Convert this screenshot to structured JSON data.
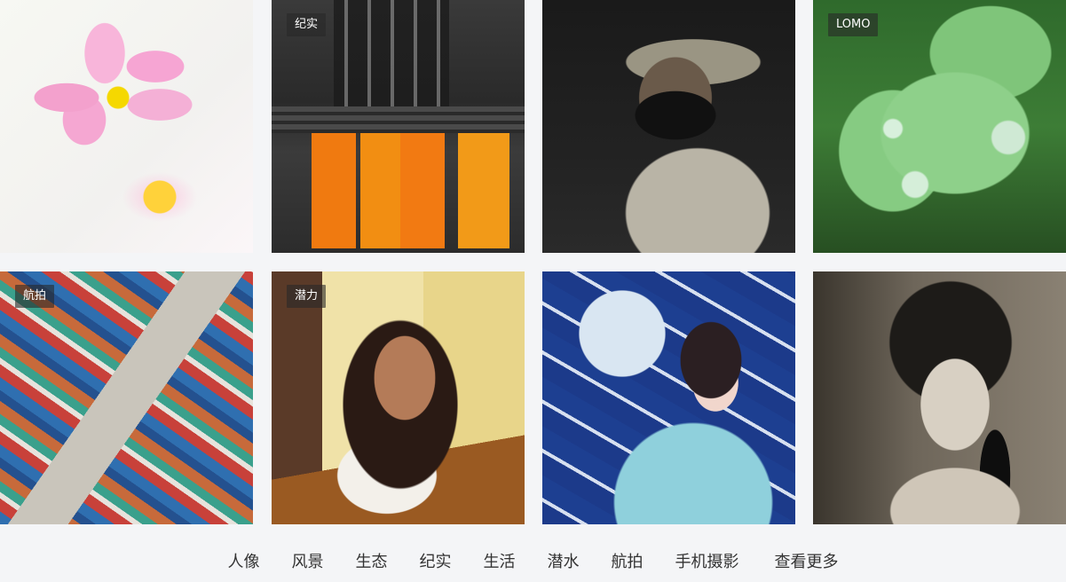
{
  "gallery": {
    "tiles": [
      {
        "alt": "pink cosmos flower",
        "tag": ""
      },
      {
        "alt": "monks in orange robes",
        "tag": "纪实"
      },
      {
        "alt": "masked old man",
        "tag": ""
      },
      {
        "alt": "green leaf with water drops",
        "tag": "LOMO"
      },
      {
        "alt": "aerial shipping containers",
        "tag": "航拍"
      },
      {
        "alt": "girl at wooden table",
        "tag": "潜力"
      },
      {
        "alt": "girl with folding fan",
        "tag": ""
      },
      {
        "alt": "woman with veil and rose",
        "tag": ""
      }
    ]
  },
  "nav": {
    "items": [
      "人像",
      "风景",
      "生态",
      "纪实",
      "生活",
      "潜水",
      "航拍",
      "手机摄影"
    ],
    "more_label": "查看更多"
  }
}
